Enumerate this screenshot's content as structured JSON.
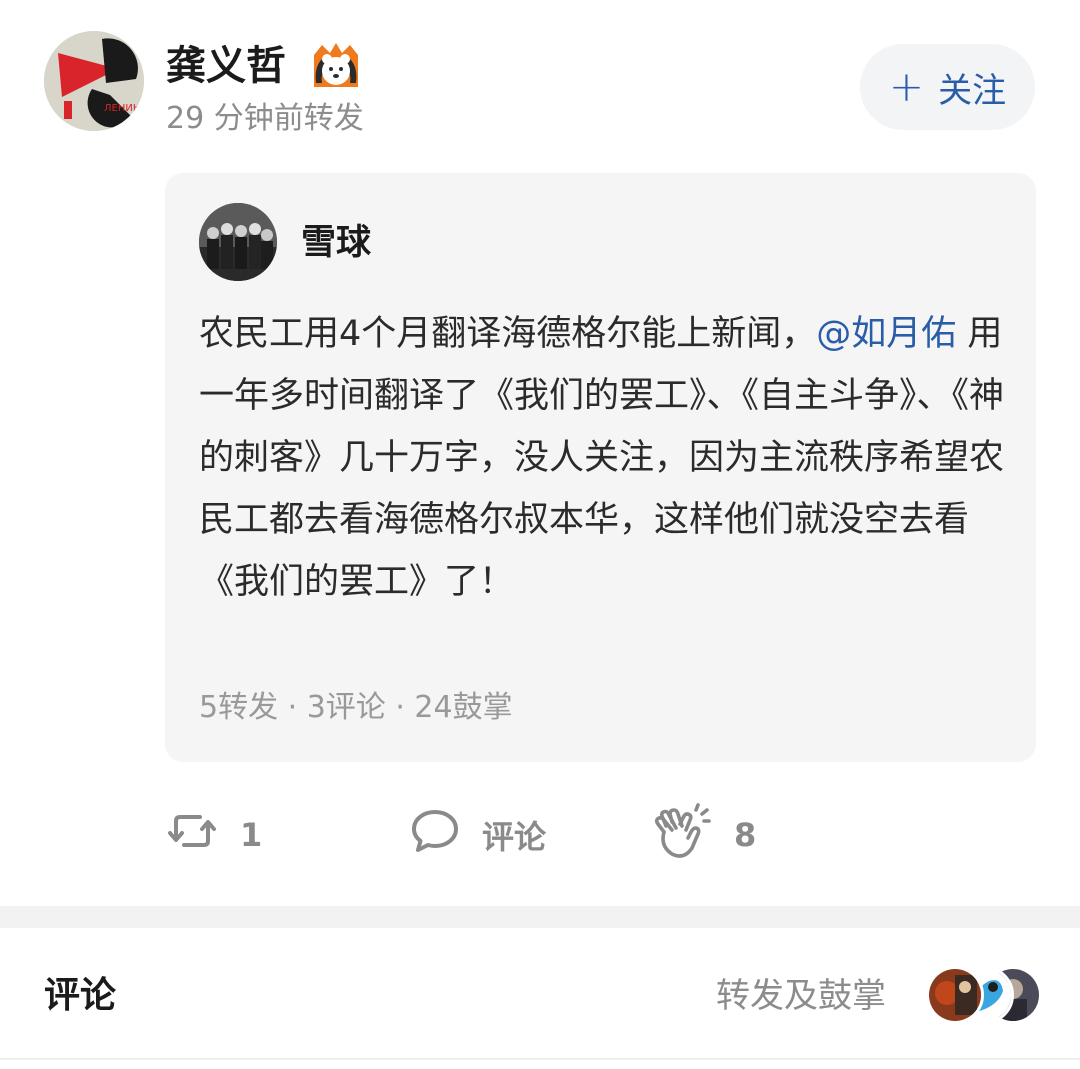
{
  "post": {
    "author": "龚义哲",
    "meta": "29 分钟前转发",
    "follow_plus": "+",
    "follow_label": "关注"
  },
  "repost": {
    "author": "雪球",
    "text_part1": "农民工用4个月翻译海德格尔能上新闻，",
    "mention": "@如月佑",
    "text_part2": " 用一年多时间翻译了《我们的罢工》、《自主斗争》、《神的刺客》几十万字，没人关注，因为主流秩序希望农民工都去看海德格尔叔本华，这样他们就没空去看《我们的罢工》了！",
    "stats": "5转发 · 3评论 · 24鼓掌"
  },
  "actions": {
    "repost_count": "1",
    "comment_label": "评论",
    "clap_count": "8"
  },
  "footer": {
    "comments_title": "评论",
    "reposts_link": "转发及鼓掌"
  },
  "colors": {
    "accent": "#2a5da8",
    "muted": "#8c8c8c",
    "card_bg": "#f5f5f6"
  }
}
